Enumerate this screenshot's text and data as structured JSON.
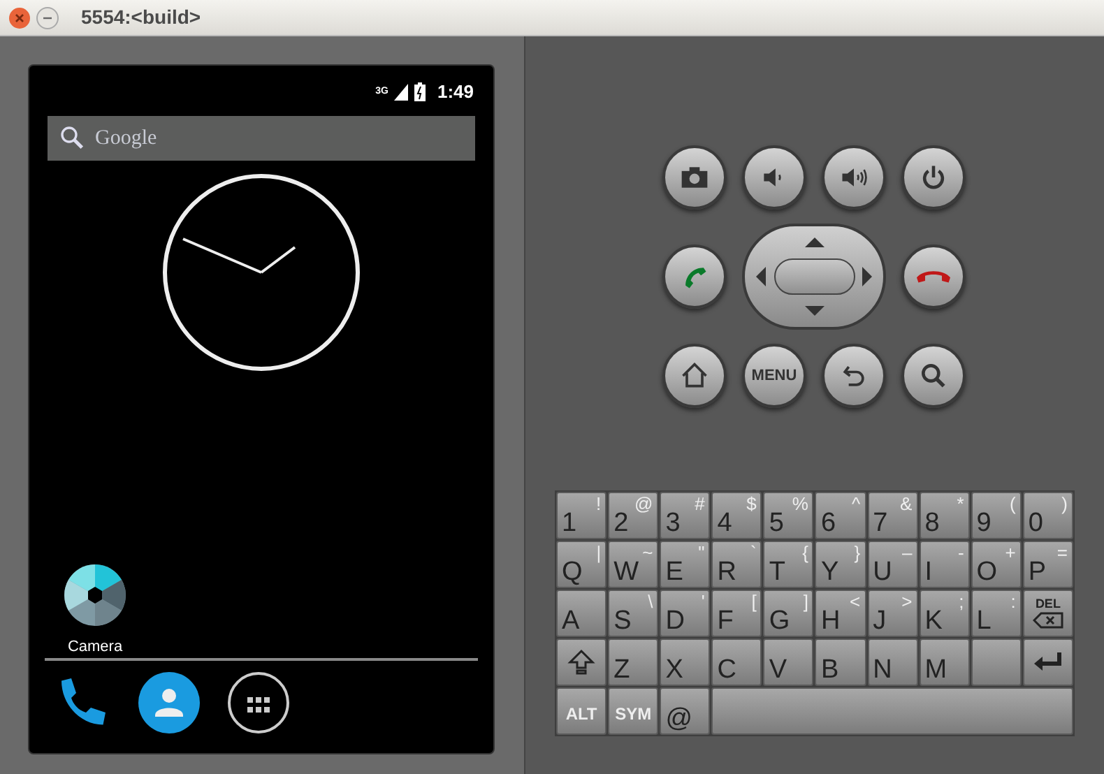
{
  "window": {
    "title": "5554:<build>"
  },
  "phone": {
    "status_bar": {
      "network": "3G",
      "time": "1:49"
    },
    "search": {
      "placeholder": "Google"
    },
    "apps": [
      {
        "label": "Camera"
      }
    ]
  },
  "hardware_buttons": {
    "menu_label": "MENU"
  },
  "keyboard": {
    "rows": [
      [
        {
          "kind": "char",
          "main": "1",
          "alt": "!"
        },
        {
          "kind": "char",
          "main": "2",
          "alt": "@"
        },
        {
          "kind": "char",
          "main": "3",
          "alt": "#"
        },
        {
          "kind": "char",
          "main": "4",
          "alt": "$"
        },
        {
          "kind": "char",
          "main": "5",
          "alt": "%"
        },
        {
          "kind": "char",
          "main": "6",
          "alt": "^"
        },
        {
          "kind": "char",
          "main": "7",
          "alt": "&"
        },
        {
          "kind": "char",
          "main": "8",
          "alt": "*"
        },
        {
          "kind": "char",
          "main": "9",
          "alt": "("
        },
        {
          "kind": "char",
          "main": "0",
          "alt": ")"
        }
      ],
      [
        {
          "kind": "char",
          "main": "Q",
          "alt": "|"
        },
        {
          "kind": "char",
          "main": "W",
          "alt": "~"
        },
        {
          "kind": "char",
          "main": "E",
          "alt": "\""
        },
        {
          "kind": "char",
          "main": "R",
          "alt": "`"
        },
        {
          "kind": "char",
          "main": "T",
          "alt": "{"
        },
        {
          "kind": "char",
          "main": "Y",
          "alt": "}"
        },
        {
          "kind": "char",
          "main": "U",
          "alt": "–"
        },
        {
          "kind": "char",
          "main": "I",
          "alt": "-"
        },
        {
          "kind": "char",
          "main": "O",
          "alt": "+"
        },
        {
          "kind": "char",
          "main": "P",
          "alt": "="
        }
      ],
      [
        {
          "kind": "char",
          "main": "A"
        },
        {
          "kind": "char",
          "main": "S",
          "alt": "\\"
        },
        {
          "kind": "char",
          "main": "D",
          "alt": "'"
        },
        {
          "kind": "char",
          "main": "F",
          "alt": "["
        },
        {
          "kind": "char",
          "main": "G",
          "alt": "]"
        },
        {
          "kind": "char",
          "main": "H",
          "alt": "<"
        },
        {
          "kind": "char",
          "main": "J",
          "alt": ">"
        },
        {
          "kind": "char",
          "main": "K",
          "alt": ";"
        },
        {
          "kind": "char",
          "main": "L",
          "alt": ":"
        },
        {
          "kind": "del",
          "main": "DEL"
        }
      ],
      [
        {
          "kind": "shift"
        },
        {
          "kind": "char",
          "main": "Z"
        },
        {
          "kind": "char",
          "main": "X"
        },
        {
          "kind": "char",
          "main": "C"
        },
        {
          "kind": "char",
          "main": "V"
        },
        {
          "kind": "char",
          "main": "B"
        },
        {
          "kind": "char",
          "main": "N"
        },
        {
          "kind": "char",
          "main": "M"
        },
        {
          "kind": "blank"
        },
        {
          "kind": "enter"
        }
      ],
      [
        {
          "kind": "label",
          "main": "ALT"
        },
        {
          "kind": "label",
          "main": "SYM"
        },
        {
          "kind": "char",
          "main": "@"
        },
        {
          "kind": "space"
        }
      ]
    ]
  }
}
